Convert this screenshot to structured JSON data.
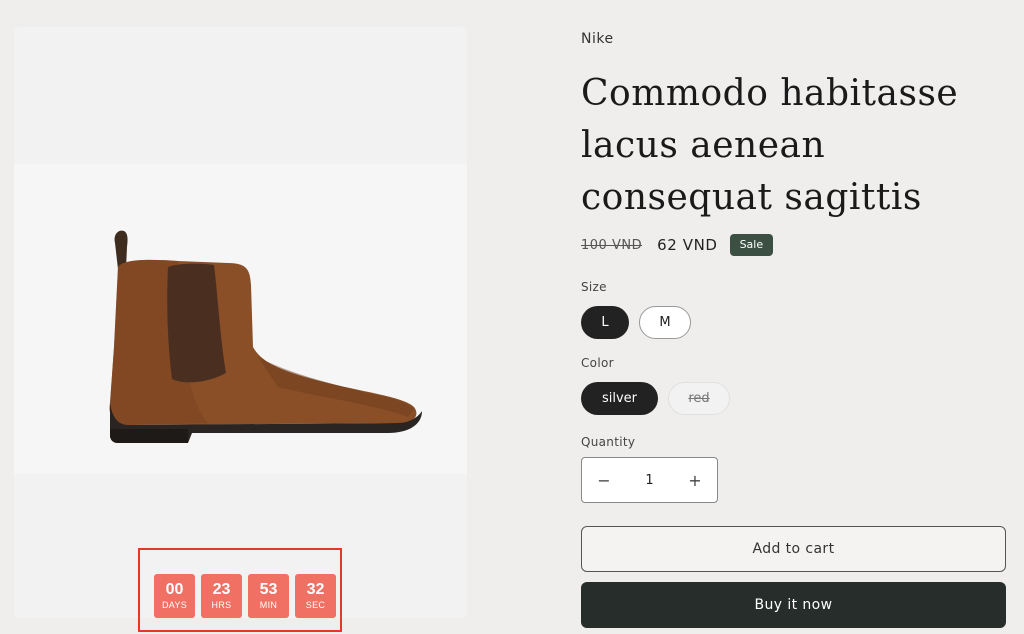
{
  "countdown": {
    "days": {
      "value": "00",
      "label": "DAYS"
    },
    "hours": {
      "value": "23",
      "label": "HRS"
    },
    "minutes": {
      "value": "53",
      "label": "MIN"
    },
    "seconds": {
      "value": "32",
      "label": "SEC"
    }
  },
  "product": {
    "vendor": "Nike",
    "title": "Commodo habitasse lacus aenean consequat sagittis",
    "price_original": "100 VND",
    "price_sale": "62 VND",
    "sale_badge": "Sale"
  },
  "options": {
    "size": {
      "label": "Size",
      "values": [
        "L",
        "M"
      ],
      "selected": "L"
    },
    "color": {
      "label": "Color",
      "values": [
        "silver",
        "red"
      ],
      "selected": "silver",
      "unavailable": [
        "red"
      ]
    }
  },
  "quantity": {
    "label": "Quantity",
    "value": "1",
    "decrease": "−",
    "increase": "+"
  },
  "actions": {
    "add_to_cart": "Add to cart",
    "buy_now": "Buy it now"
  },
  "colors": {
    "accent_badge": "#3b4f43",
    "countdown_box": "#f07063",
    "highlight_border": "#e43a25",
    "buy_button": "#262d2a"
  }
}
